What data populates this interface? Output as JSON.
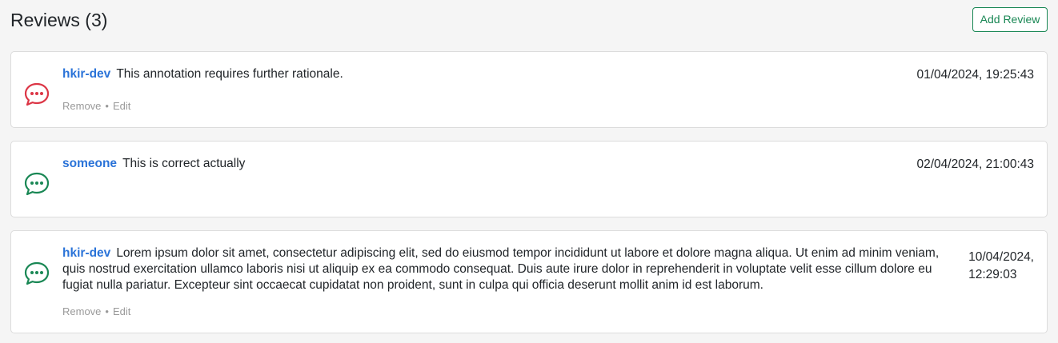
{
  "header": {
    "title": "Reviews (3)",
    "add_label": "Add Review"
  },
  "colors": {
    "author": "#2a73d8",
    "icon_flagged": "#dc3545",
    "icon_ok": "#198754",
    "button_accent": "#198754"
  },
  "reviews": [
    {
      "author": "hkir-dev",
      "text": "This annotation requires further rationale.",
      "timestamp": "01/04/2024, 19:25:43",
      "icon": "chat-bubble-dots-icon",
      "icon_color": "#dc3545",
      "remove_label": "Remove",
      "separator": "•",
      "edit_label": "Edit"
    },
    {
      "author": "someone",
      "text": "This is correct actually",
      "timestamp": "02/04/2024, 21:00:43",
      "icon": "chat-bubble-dots-icon",
      "icon_color": "#198754"
    },
    {
      "author": "hkir-dev",
      "text": "Lorem ipsum dolor sit amet, consectetur adipiscing elit, sed do eiusmod tempor incididunt ut labore et dolore magna aliqua. Ut enim ad minim veniam, quis nostrud exercitation ullamco laboris nisi ut aliquip ex ea commodo consequat. Duis aute irure dolor in reprehenderit in voluptate velit esse cillum dolore eu fugiat nulla pariatur. Excepteur sint occaecat cupidatat non proident, sunt in culpa qui officia deserunt mollit anim id est laborum.",
      "timestamp_line1": "10/04/2024,",
      "timestamp_line2": "12:29:03",
      "icon": "chat-bubble-dots-icon",
      "icon_color": "#198754",
      "remove_label": "Remove",
      "separator": "•",
      "edit_label": "Edit"
    }
  ]
}
